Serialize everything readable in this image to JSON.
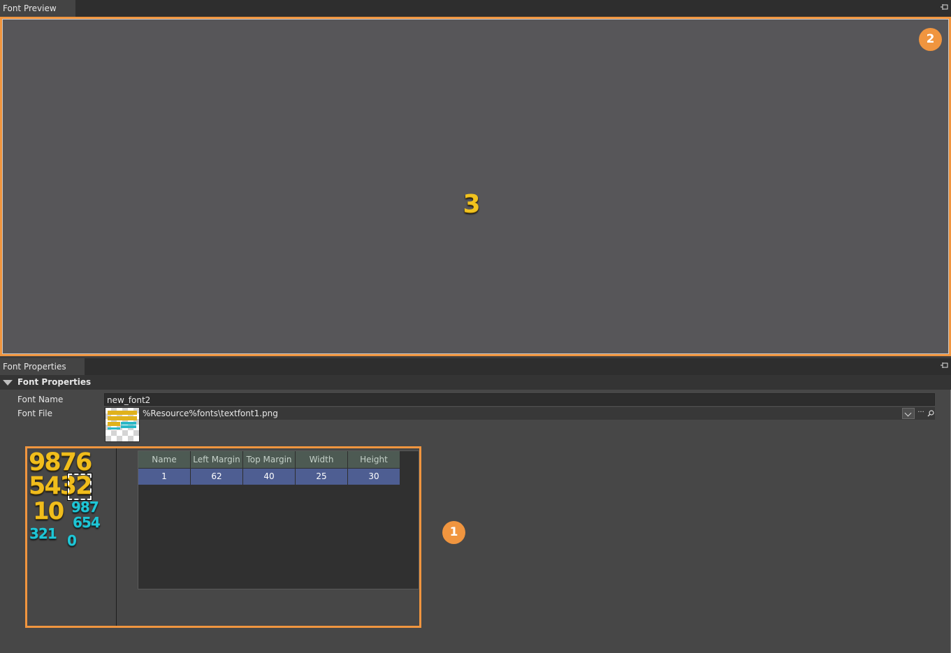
{
  "preview": {
    "tab_label": "Font Preview",
    "preview_glyph": "3",
    "badge": "2"
  },
  "properties": {
    "tab_label": "Font Properties",
    "section_title": "Font Properties",
    "font_name_label": "Font Name",
    "font_name_value": "new_font2",
    "font_file_label": "Font File",
    "font_file_value": "%Resource%fonts\\textfont1.png",
    "browse_label": "···",
    "badge": "1"
  },
  "atlas": {
    "row_1": "9876",
    "row_2_left": "54",
    "row_2_selected": "3",
    "row_2_right": "2",
    "row_3_gold": "10",
    "row_3_cyan": "987",
    "row_4_cyan": "654",
    "row_5_cyan": "321",
    "row_5b_cyan": "0"
  },
  "char_table": {
    "columns": [
      "Name",
      "Left Margin",
      "Top Margin",
      "Width",
      "Height"
    ],
    "rows": [
      [
        "1",
        "62",
        "40",
        "25",
        "30"
      ]
    ]
  },
  "colors": {
    "highlight": "#f0953f",
    "glyph_gold": "#f0bd1c",
    "glyph_cyan": "#1fc6d6",
    "selected_row": "#4e5e92"
  },
  "icons": [
    "pin-icon",
    "collapse-triangle-icon",
    "chevron-down-icon",
    "search-icon"
  ]
}
